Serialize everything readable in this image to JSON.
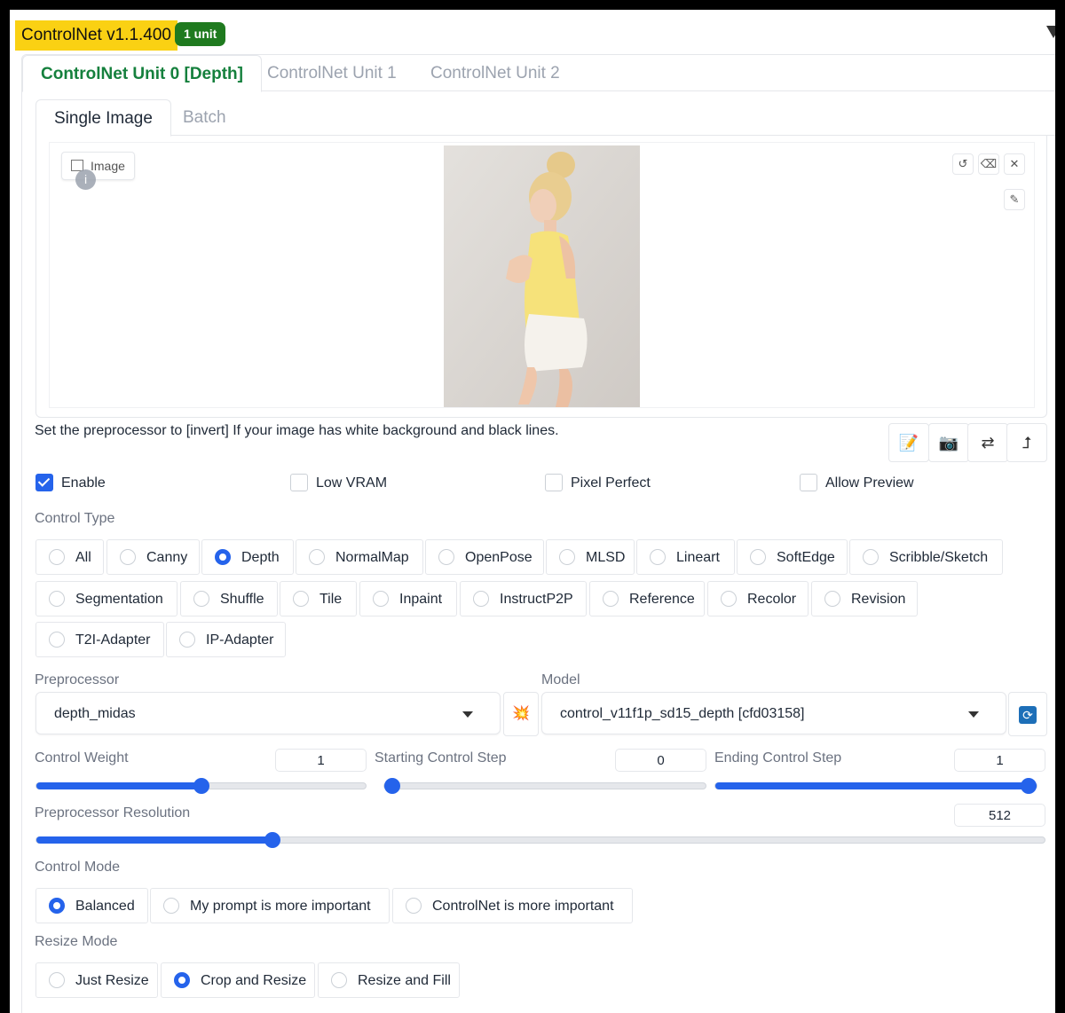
{
  "header": {
    "title": "ControlNet v1.1.400",
    "badge": "1 unit"
  },
  "unit_tabs": [
    {
      "label": "ControlNet Unit 0 [Depth]",
      "active": true
    },
    {
      "label": "ControlNet Unit 1",
      "active": false
    },
    {
      "label": "ControlNet Unit 2",
      "active": false
    }
  ],
  "image_tabs": [
    {
      "label": "Single Image",
      "active": true
    },
    {
      "label": "Batch",
      "active": false
    }
  ],
  "image_panel": {
    "label": "Image",
    "info": "i",
    "icons": [
      "undo-icon",
      "eraser-icon",
      "close-icon",
      "brush-icon"
    ]
  },
  "hint": "Set the preprocessor to [invert] If your image has white background and black lines.",
  "tool_buttons": [
    "notepad-icon",
    "camera-icon",
    "swap-icon",
    "send-icon"
  ],
  "checkboxes": [
    {
      "label": "Enable",
      "checked": true
    },
    {
      "label": "Low VRAM",
      "checked": false
    },
    {
      "label": "Pixel Perfect",
      "checked": false
    },
    {
      "label": "Allow Preview",
      "checked": false
    }
  ],
  "control_type": {
    "label": "Control Type",
    "options": [
      "All",
      "Canny",
      "Depth",
      "NormalMap",
      "OpenPose",
      "MLSD",
      "Lineart",
      "SoftEdge",
      "Scribble/Sketch",
      "Segmentation",
      "Shuffle",
      "Tile",
      "Inpaint",
      "InstructP2P",
      "Reference",
      "Recolor",
      "Revision",
      "T2I-Adapter",
      "IP-Adapter"
    ],
    "selected": "Depth"
  },
  "preprocessor": {
    "label": "Preprocessor",
    "value": "depth_midas",
    "run_icon": "💥"
  },
  "model": {
    "label": "Model",
    "value": "control_v11f1p_sd15_depth [cfd03158]",
    "refresh_icon": "🔄"
  },
  "sliders": {
    "control_weight": {
      "label": "Control Weight",
      "value": "1",
      "fraction": 0.5
    },
    "starting_step": {
      "label": "Starting Control Step",
      "value": "0",
      "fraction": 0.0
    },
    "ending_step": {
      "label": "Ending Control Step",
      "value": "1",
      "fraction": 1.0
    },
    "resolution": {
      "label": "Preprocessor Resolution",
      "value": "512",
      "fraction": 0.234
    }
  },
  "control_mode": {
    "label": "Control Mode",
    "options": [
      "Balanced",
      "My prompt is more important",
      "ControlNet is more important"
    ],
    "selected": "Balanced"
  },
  "resize_mode": {
    "label": "Resize Mode",
    "options": [
      "Just Resize",
      "Crop and Resize",
      "Resize and Fill"
    ],
    "selected": "Crop and Resize"
  },
  "colors": {
    "accent": "#2563eb",
    "active_tab": "#15803d",
    "title_bg": "#fad113",
    "badge_bg": "#1f7a1f"
  }
}
